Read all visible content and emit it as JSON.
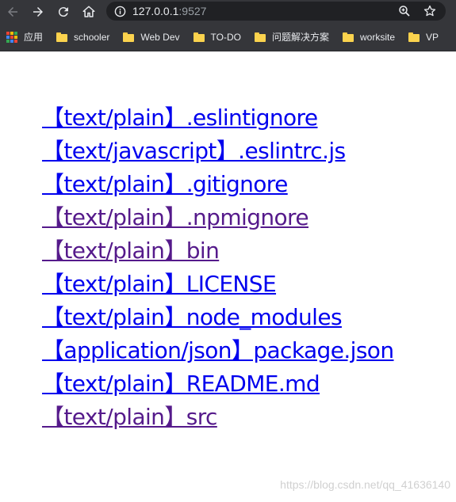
{
  "browser": {
    "url_host": "127.0.0.1",
    "url_port": ":9527",
    "icons": {
      "back": "arrow-left-icon",
      "forward": "arrow-right-icon",
      "reload": "reload-icon",
      "home": "home-icon",
      "site_info": "info-icon",
      "zoom": "zoom-icon",
      "bookmark": "star-icon"
    }
  },
  "bookmarks": [
    {
      "label": "应用",
      "icon": "apps-icon"
    },
    {
      "label": "schooler",
      "icon": "folder-icon"
    },
    {
      "label": "Web Dev",
      "icon": "folder-icon"
    },
    {
      "label": "TO-DO",
      "icon": "folder-icon"
    },
    {
      "label": "问题解决方案",
      "icon": "folder-icon"
    },
    {
      "label": "worksite",
      "icon": "folder-icon"
    },
    {
      "label": "VP",
      "icon": "folder-icon"
    }
  ],
  "files": [
    {
      "text": "【text/plain】.eslintignore",
      "visited": false
    },
    {
      "text": "【text/javascript】.eslintrc.js",
      "visited": false
    },
    {
      "text": "【text/plain】.gitignore",
      "visited": false
    },
    {
      "text": "【text/plain】.npmignore",
      "visited": true
    },
    {
      "text": "【text/plain】bin",
      "visited": true
    },
    {
      "text": "【text/plain】LICENSE",
      "visited": false
    },
    {
      "text": "【text/plain】node_modules",
      "visited": false
    },
    {
      "text": "【application/json】package.json",
      "visited": false
    },
    {
      "text": "【text/plain】README.md",
      "visited": false
    },
    {
      "text": "【text/plain】src",
      "visited": true
    }
  ],
  "watermark": "https://blog.csdn.net/qq_41636140",
  "colors": {
    "link": "#0000ee",
    "visited_link": "#551a8b",
    "chrome_bg": "#35363a",
    "omnibox_bg": "#202124"
  }
}
